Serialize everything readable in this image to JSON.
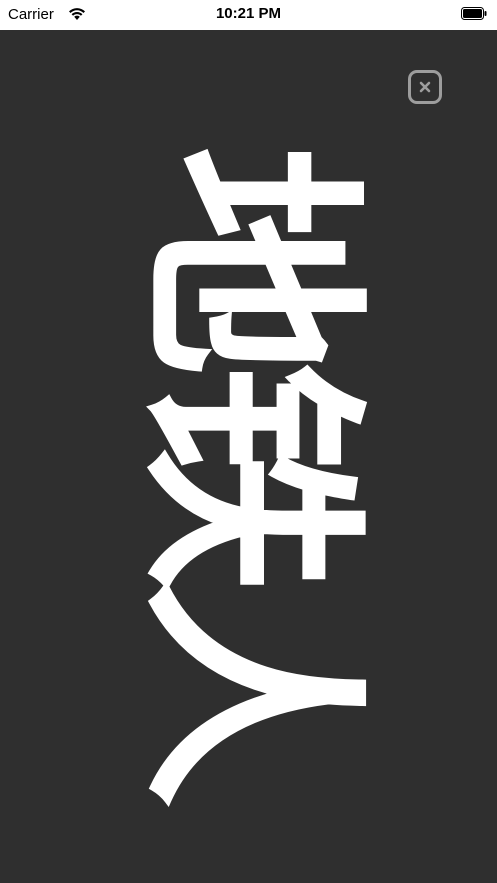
{
  "status_bar": {
    "carrier": "Carrier",
    "time": "10:21 PM",
    "wifi_icon": "wifi-icon",
    "battery_icon": "battery-icon"
  },
  "display": {
    "text": "地铁人",
    "background_color": "#2f2f2f",
    "text_color": "#ffffff",
    "orientation": "rotated-90"
  },
  "close_button": {
    "icon": "close-icon",
    "border_color": "#9d9d9d"
  }
}
